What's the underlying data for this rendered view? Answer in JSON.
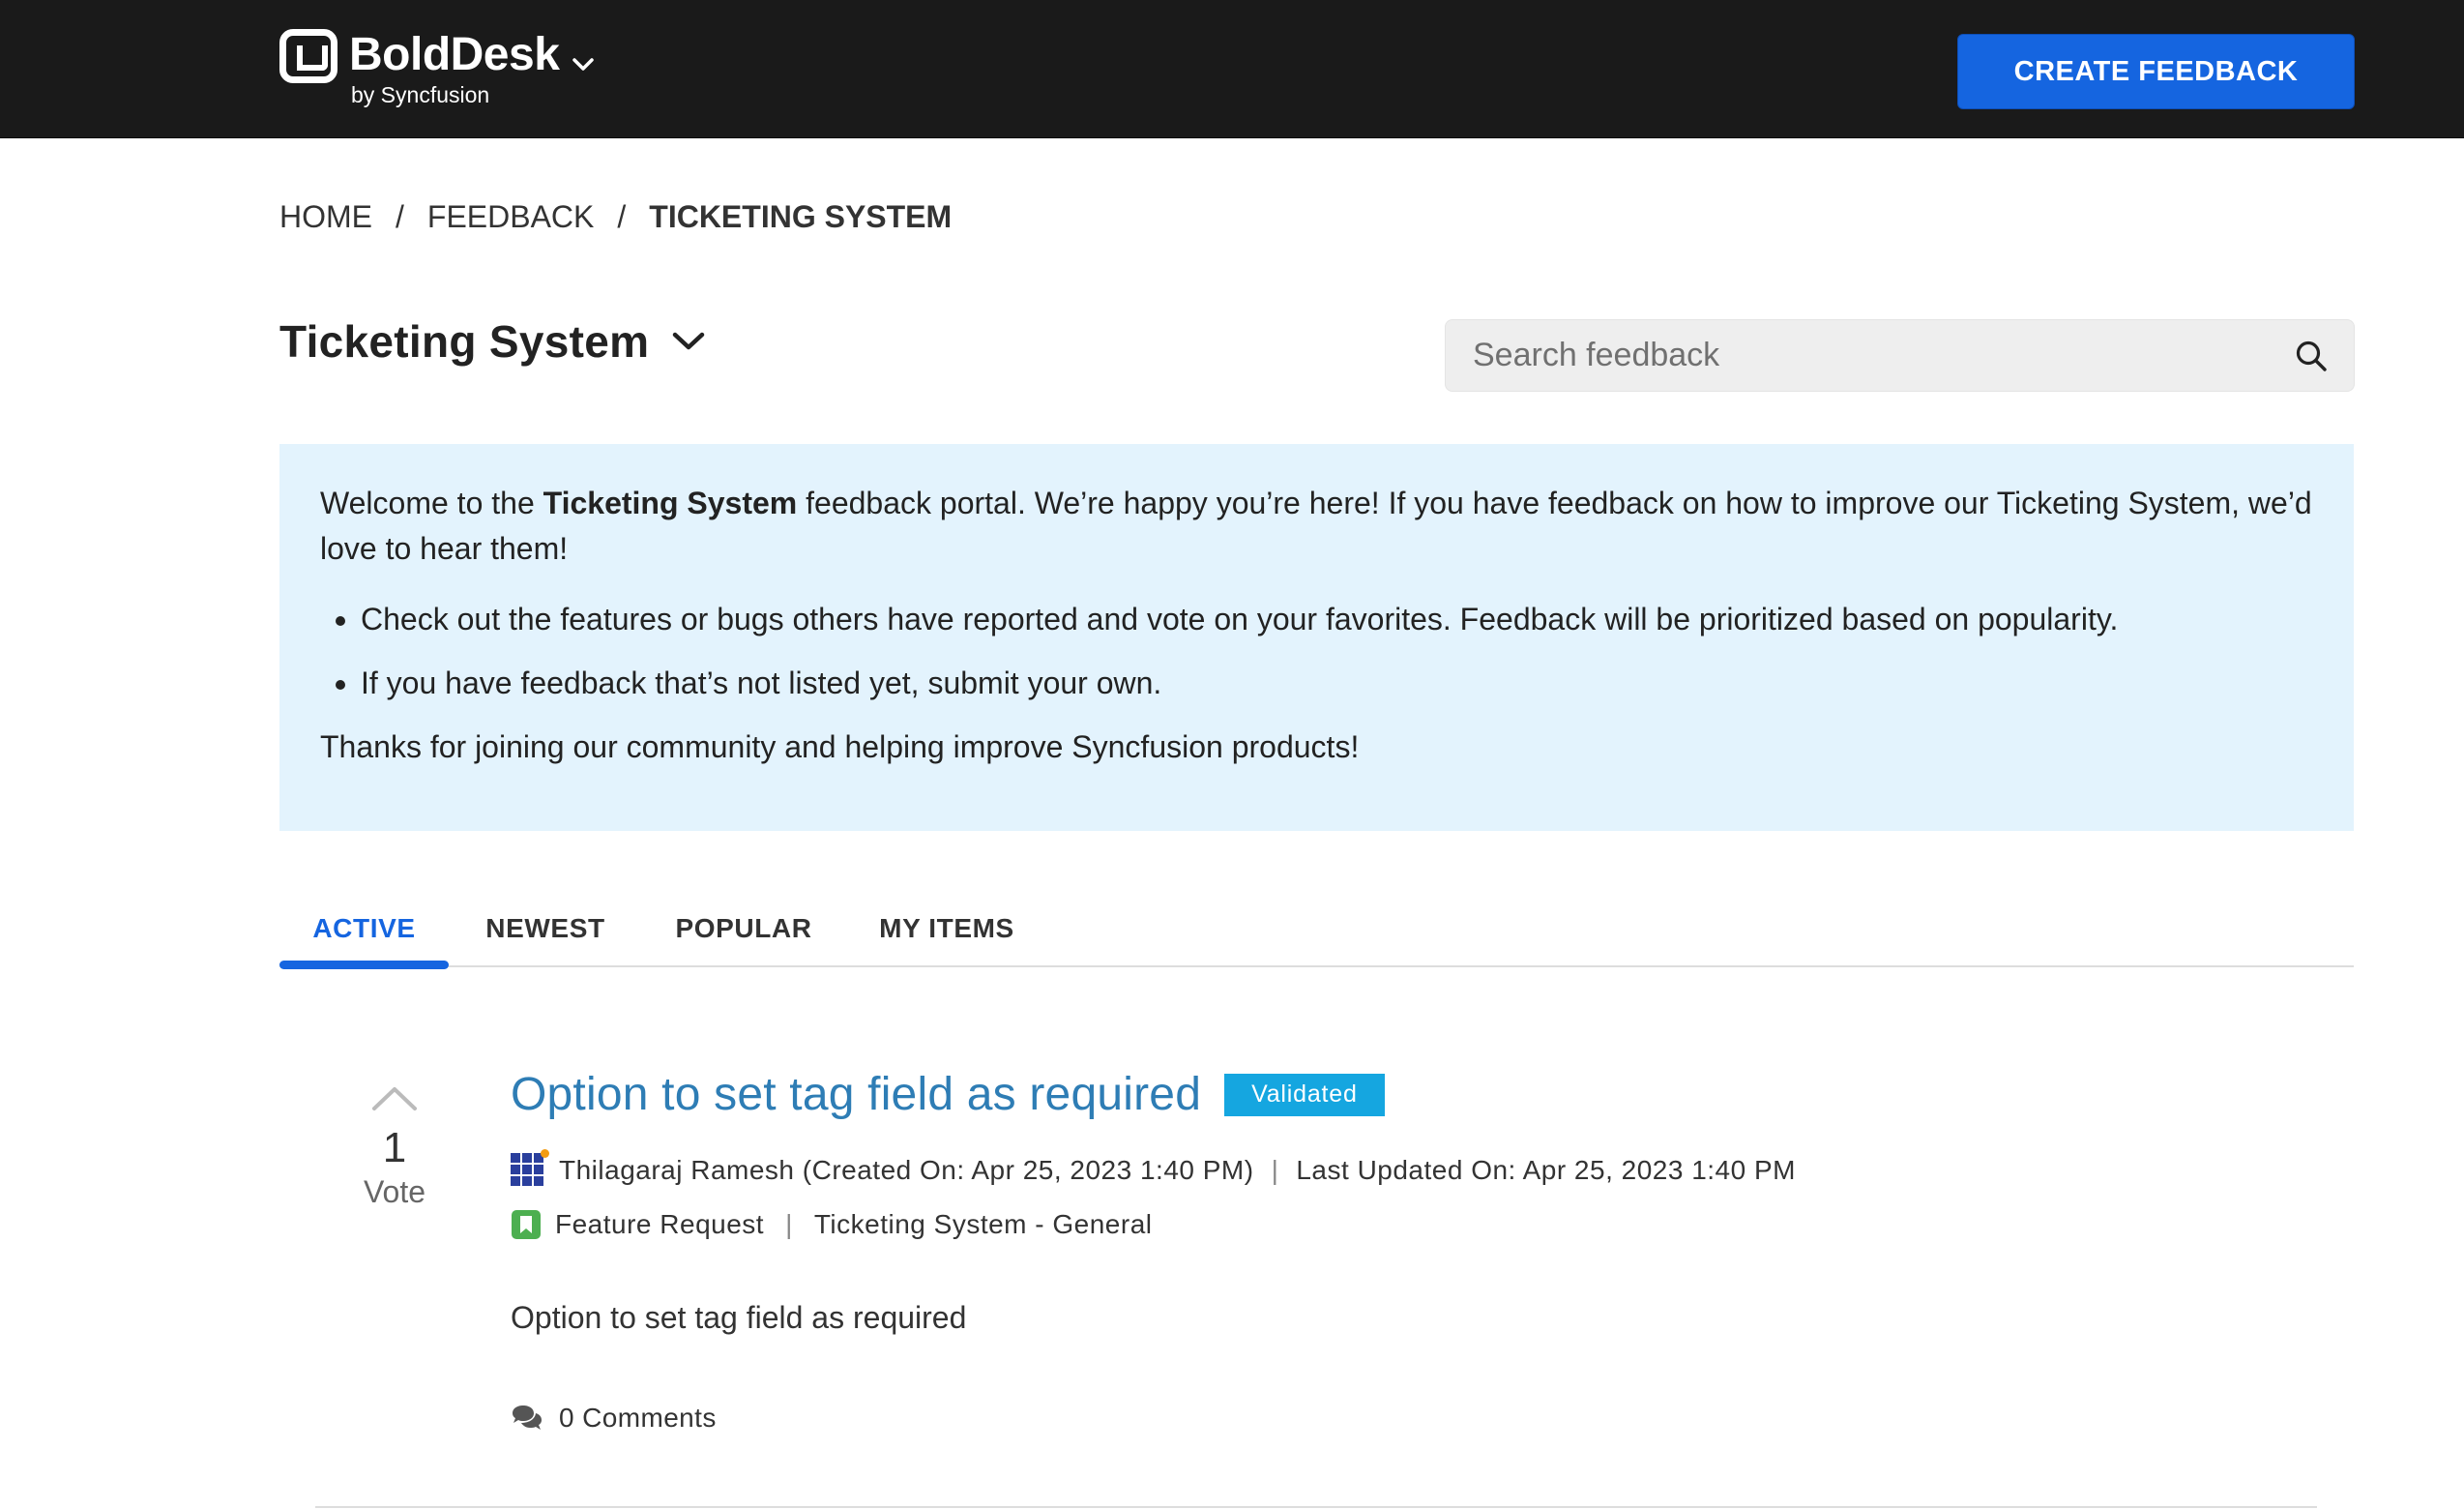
{
  "header": {
    "brand_name": "BoldDesk",
    "brand_sub": "by Syncfusion",
    "create_button": "CREATE FEEDBACK"
  },
  "breadcrumb": {
    "home": "HOME",
    "feedback": "FEEDBACK",
    "current": "TICKETING SYSTEM",
    "separator": "/"
  },
  "page": {
    "title": "Ticketing System"
  },
  "search": {
    "placeholder": "Search feedback",
    "value": ""
  },
  "welcome": {
    "intro_before": "Welcome to the ",
    "intro_bold": "Ticketing System",
    "intro_after": " feedback portal. We’re happy you’re here! If you have feedback on how to improve our Ticketing System, we’d love to hear them!",
    "bullets": [
      "Check out the features or bugs others have reported and vote on your favorites. Feedback will be prioritized based on popularity.",
      "If you have feedback that’s not listed yet, submit your own."
    ],
    "thanks": "Thanks for joining our community and helping improve Syncfusion products!"
  },
  "tabs": [
    {
      "label": "ACTIVE",
      "active": true
    },
    {
      "label": "NEWEST",
      "active": false
    },
    {
      "label": "POPULAR",
      "active": false
    },
    {
      "label": "MY ITEMS",
      "active": false
    }
  ],
  "item": {
    "votes": "1",
    "vote_label": "Vote",
    "title": "Option to set tag field as required",
    "status": "Validated",
    "author_meta": "Thilagaraj Ramesh (Created On: Apr 25, 2023 1:40 PM)",
    "updated": "Last Updated On: Apr 25, 2023 1:40 PM",
    "type": "Feature Request",
    "category": "Ticketing System - General",
    "description": "Option to set tag field as required",
    "comments": "0 Comments"
  },
  "colors": {
    "accent": "#1565e0",
    "link": "#2e7db5",
    "badge": "#15a6e0",
    "welcome_bg": "#e3f3fd",
    "header_bg": "#1a1a1a",
    "feature_icon": "#4caf50"
  },
  "icons": {
    "brand": "bolddesk-logo-icon",
    "brand_menu": "chevron-down-icon",
    "title_menu": "chevron-down-icon",
    "search": "search-icon",
    "upvote": "chevron-up-icon",
    "avatar": "grid-avatar-icon",
    "type": "bookmark-icon",
    "comments": "comments-icon"
  }
}
